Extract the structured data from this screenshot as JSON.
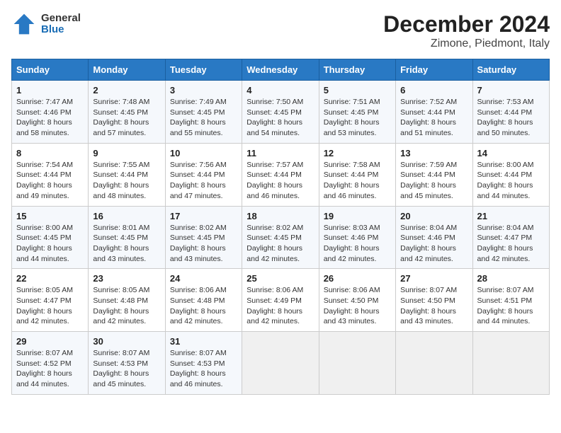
{
  "header": {
    "logo_line1": "General",
    "logo_line2": "Blue",
    "title": "December 2024",
    "subtitle": "Zimone, Piedmont, Italy"
  },
  "weekdays": [
    "Sunday",
    "Monday",
    "Tuesday",
    "Wednesday",
    "Thursday",
    "Friday",
    "Saturday"
  ],
  "weeks": [
    [
      {
        "day": 1,
        "sunrise": "7:47 AM",
        "sunset": "4:46 PM",
        "daylight": "8 hours and 58 minutes."
      },
      {
        "day": 2,
        "sunrise": "7:48 AM",
        "sunset": "4:45 PM",
        "daylight": "8 hours and 57 minutes."
      },
      {
        "day": 3,
        "sunrise": "7:49 AM",
        "sunset": "4:45 PM",
        "daylight": "8 hours and 55 minutes."
      },
      {
        "day": 4,
        "sunrise": "7:50 AM",
        "sunset": "4:45 PM",
        "daylight": "8 hours and 54 minutes."
      },
      {
        "day": 5,
        "sunrise": "7:51 AM",
        "sunset": "4:45 PM",
        "daylight": "8 hours and 53 minutes."
      },
      {
        "day": 6,
        "sunrise": "7:52 AM",
        "sunset": "4:44 PM",
        "daylight": "8 hours and 51 minutes."
      },
      {
        "day": 7,
        "sunrise": "7:53 AM",
        "sunset": "4:44 PM",
        "daylight": "8 hours and 50 minutes."
      }
    ],
    [
      {
        "day": 8,
        "sunrise": "7:54 AM",
        "sunset": "4:44 PM",
        "daylight": "8 hours and 49 minutes."
      },
      {
        "day": 9,
        "sunrise": "7:55 AM",
        "sunset": "4:44 PM",
        "daylight": "8 hours and 48 minutes."
      },
      {
        "day": 10,
        "sunrise": "7:56 AM",
        "sunset": "4:44 PM",
        "daylight": "8 hours and 47 minutes."
      },
      {
        "day": 11,
        "sunrise": "7:57 AM",
        "sunset": "4:44 PM",
        "daylight": "8 hours and 46 minutes."
      },
      {
        "day": 12,
        "sunrise": "7:58 AM",
        "sunset": "4:44 PM",
        "daylight": "8 hours and 46 minutes."
      },
      {
        "day": 13,
        "sunrise": "7:59 AM",
        "sunset": "4:44 PM",
        "daylight": "8 hours and 45 minutes."
      },
      {
        "day": 14,
        "sunrise": "8:00 AM",
        "sunset": "4:44 PM",
        "daylight": "8 hours and 44 minutes."
      }
    ],
    [
      {
        "day": 15,
        "sunrise": "8:00 AM",
        "sunset": "4:45 PM",
        "daylight": "8 hours and 44 minutes."
      },
      {
        "day": 16,
        "sunrise": "8:01 AM",
        "sunset": "4:45 PM",
        "daylight": "8 hours and 43 minutes."
      },
      {
        "day": 17,
        "sunrise": "8:02 AM",
        "sunset": "4:45 PM",
        "daylight": "8 hours and 43 minutes."
      },
      {
        "day": 18,
        "sunrise": "8:02 AM",
        "sunset": "4:45 PM",
        "daylight": "8 hours and 42 minutes."
      },
      {
        "day": 19,
        "sunrise": "8:03 AM",
        "sunset": "4:46 PM",
        "daylight": "8 hours and 42 minutes."
      },
      {
        "day": 20,
        "sunrise": "8:04 AM",
        "sunset": "4:46 PM",
        "daylight": "8 hours and 42 minutes."
      },
      {
        "day": 21,
        "sunrise": "8:04 AM",
        "sunset": "4:47 PM",
        "daylight": "8 hours and 42 minutes."
      }
    ],
    [
      {
        "day": 22,
        "sunrise": "8:05 AM",
        "sunset": "4:47 PM",
        "daylight": "8 hours and 42 minutes."
      },
      {
        "day": 23,
        "sunrise": "8:05 AM",
        "sunset": "4:48 PM",
        "daylight": "8 hours and 42 minutes."
      },
      {
        "day": 24,
        "sunrise": "8:06 AM",
        "sunset": "4:48 PM",
        "daylight": "8 hours and 42 minutes."
      },
      {
        "day": 25,
        "sunrise": "8:06 AM",
        "sunset": "4:49 PM",
        "daylight": "8 hours and 42 minutes."
      },
      {
        "day": 26,
        "sunrise": "8:06 AM",
        "sunset": "4:50 PM",
        "daylight": "8 hours and 43 minutes."
      },
      {
        "day": 27,
        "sunrise": "8:07 AM",
        "sunset": "4:50 PM",
        "daylight": "8 hours and 43 minutes."
      },
      {
        "day": 28,
        "sunrise": "8:07 AM",
        "sunset": "4:51 PM",
        "daylight": "8 hours and 44 minutes."
      }
    ],
    [
      {
        "day": 29,
        "sunrise": "8:07 AM",
        "sunset": "4:52 PM",
        "daylight": "8 hours and 44 minutes."
      },
      {
        "day": 30,
        "sunrise": "8:07 AM",
        "sunset": "4:53 PM",
        "daylight": "8 hours and 45 minutes."
      },
      {
        "day": 31,
        "sunrise": "8:07 AM",
        "sunset": "4:53 PM",
        "daylight": "8 hours and 46 minutes."
      },
      null,
      null,
      null,
      null
    ]
  ]
}
